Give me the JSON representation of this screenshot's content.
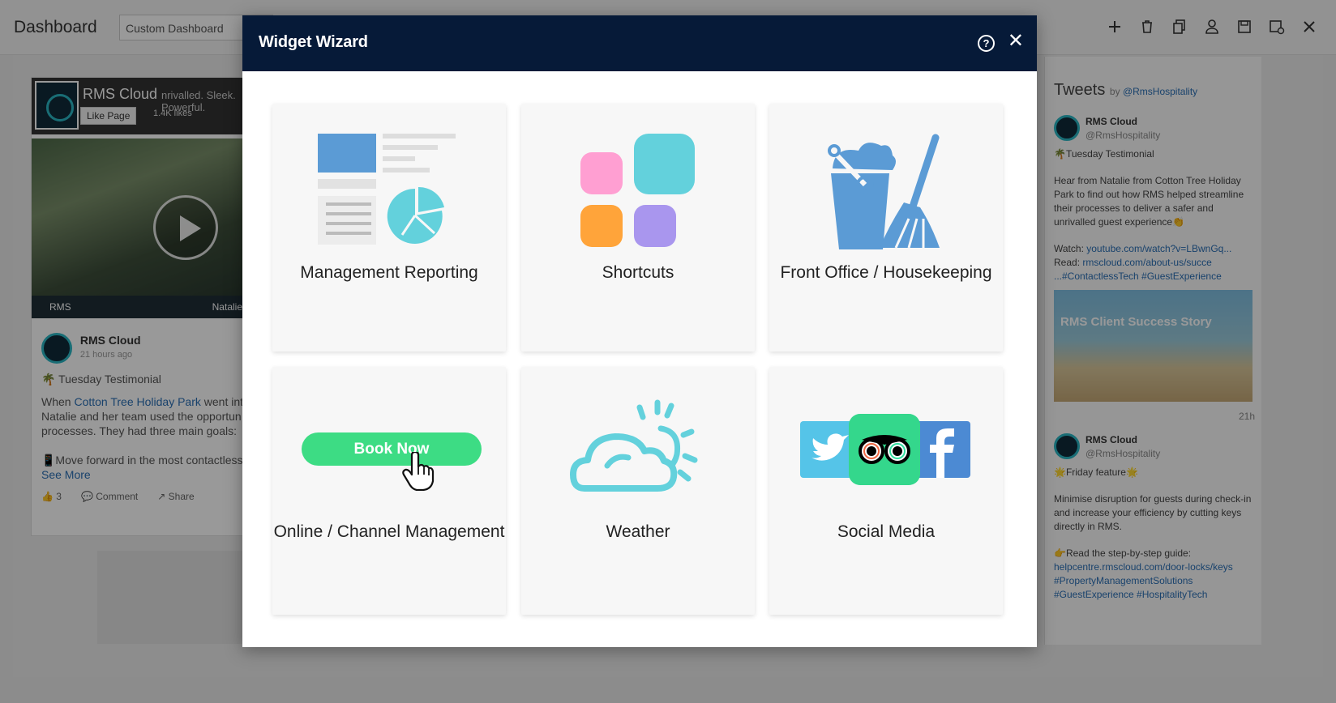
{
  "dashboard": {
    "title": "Dashboard",
    "select_value": "Custom Dashboard",
    "toolbar_icons": [
      "plus-icon",
      "trash-icon",
      "copy-icon",
      "user-icon",
      "save-icon",
      "save-settings-icon",
      "close-icon"
    ]
  },
  "facebook_widget": {
    "page_name": "RMS Cloud",
    "like_button": "Like Page",
    "likes": "1.4K likes",
    "tagline": "nrivalled. Sleek. Powerful.",
    "video_brand": "RMS",
    "video_caption": "Natalie",
    "post_author": "RMS Cloud",
    "post_time": "21 hours ago",
    "post_heading": "🌴 Tuesday Testimonial",
    "post_text_1": "When ",
    "post_link": "Cotton Tree Holiday Park",
    "post_text_2": " went int\nNatalie and her team used the opportun\nprocesses. They had three main goals:\n\n📱Move forward in the most contactless",
    "see_more": "See More",
    "like_count": "3",
    "comment_label": "Comment",
    "share_label": "Share"
  },
  "twitter_widget": {
    "title": "Tweets",
    "by_label": "by",
    "handle": "@RmsHospitality",
    "tweets": [
      {
        "name": "RMS Cloud",
        "handle": "@RmsHospitality",
        "heading": "🌴Tuesday Testimonial",
        "text": "Hear from Natalie from Cotton Tree Holiday Park to find out  how RMS helped streamline their processes to deliver a safer and unrivalled guest experience👏",
        "watch_label": "Watch: ",
        "watch_link": "youtube.com/watch?v=LBwnGq...",
        "read_label": "Read: ",
        "read_link": "rmscloud.com/about-us/succe",
        "tags": "...#ContactlessTech #GuestExperience",
        "image_text": "RMS Client Success Story",
        "time": "21h"
      },
      {
        "name": "RMS Cloud",
        "handle": "@RmsHospitality",
        "heading": "🌟Friday feature🌟",
        "text": "Minimise disruption for guests during check-in and increase your efficiency by cutting keys directly in RMS.",
        "guide_label": "👉Read the step-by-step guide:",
        "guide_link": "helpcentre.rmscloud.com/door-locks/keys",
        "tags": "#PropertyManagementSolutions\n#GuestExperience #HospitalityTech"
      }
    ]
  },
  "modal": {
    "title": "Widget Wizard",
    "help_icon": "help-icon",
    "close_icon": "close-icon",
    "tiles": [
      {
        "label": "Management Reporting",
        "icon": "report-icon"
      },
      {
        "label": "Shortcuts",
        "icon": "shortcuts-icon"
      },
      {
        "label": "Front Office / Housekeeping",
        "icon": "housekeeping-icon"
      },
      {
        "label": "Online / Channel Management",
        "icon": "book-now-icon",
        "button_text": "Book Now"
      },
      {
        "label": "Weather",
        "icon": "weather-icon"
      },
      {
        "label": "Social Media",
        "icon": "social-media-icon"
      }
    ]
  },
  "colors": {
    "modal_header": "#061a38",
    "accent_blue": "#5b9bd5",
    "accent_teal": "#63d1dc",
    "book_now_green": "#3ddc84",
    "tripadvisor_green": "#34e0a1",
    "facebook_blue": "#4c8ad3",
    "twitter_blue": "#55c4e8"
  }
}
